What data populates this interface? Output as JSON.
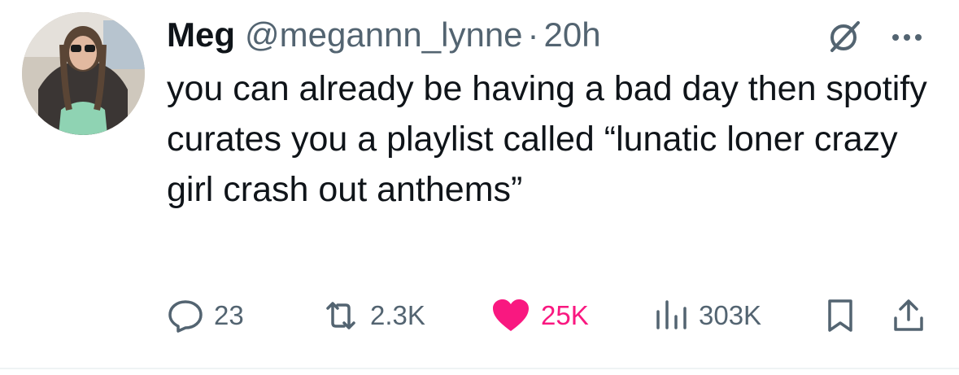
{
  "tweet": {
    "author_name": "Meg",
    "handle": "@megannn_lynne",
    "separator": "·",
    "time": "20h",
    "text": "you can already be having a bad day then spotify curates you a playlist called “lunatic loner crazy girl crash out anthems”"
  },
  "actions": {
    "replies": "23",
    "reposts": "2.3K",
    "likes": "25K",
    "views": "303K"
  },
  "colors": {
    "text_primary": "#0f1419",
    "text_secondary": "#536471",
    "like_active": "#f91880"
  },
  "icons": [
    "grok-icon",
    "more-icon",
    "reply-icon",
    "repost-icon",
    "heart-icon",
    "views-icon",
    "bookmark-icon",
    "share-icon"
  ]
}
